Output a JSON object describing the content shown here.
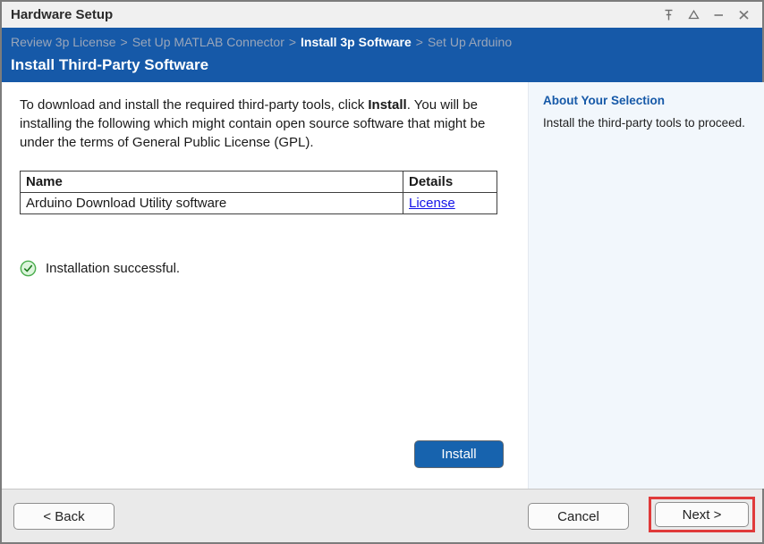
{
  "title_bar": {
    "title": "Hardware Setup",
    "icons": [
      "pin",
      "dock-triangle",
      "minimize",
      "close"
    ]
  },
  "breadcrumb": {
    "separator": ">",
    "items": [
      {
        "label": "Review 3p License",
        "active": false
      },
      {
        "label": "Set Up MATLAB Connector",
        "active": false
      },
      {
        "label": "Install 3p Software",
        "active": true
      },
      {
        "label": "Set Up Arduino",
        "active": false
      }
    ]
  },
  "header": {
    "heading": "Install Third-Party Software"
  },
  "main": {
    "intro": {
      "text1": "To download and install the required third-party tools, click ",
      "bold": "Install",
      "text2": ". You will be installing the following which might contain open source software that might be under the terms of General Public License (GPL)."
    },
    "table": {
      "columns": [
        "Name",
        "Details"
      ],
      "rows": [
        {
          "name": "Arduino Download Utility software",
          "details_link": "License"
        }
      ]
    },
    "status": {
      "icon": "success-check",
      "text": "Installation successful."
    },
    "install_button": "Install"
  },
  "sidebar": {
    "heading": "About Your Selection",
    "text": "Install the third-party tools to proceed."
  },
  "footer": {
    "back": "< Back",
    "cancel": "Cancel",
    "next": "Next >"
  },
  "colors": {
    "header_blue": "#1659a8",
    "panel_bg": "#f2f7fc",
    "link_blue": "#1212e8",
    "success_green": "#4cae4f",
    "highlight_red": "#e03a3a",
    "install_button_blue": "#1763ae"
  }
}
